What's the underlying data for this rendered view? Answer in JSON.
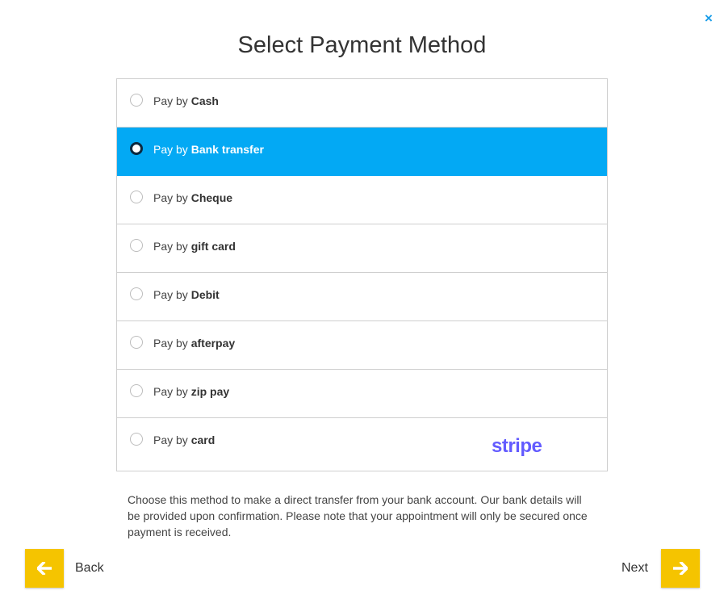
{
  "close_label": "×",
  "title": "Select Payment Method",
  "options": [
    {
      "prefix": "Pay by",
      "method": "Cash",
      "selected": false
    },
    {
      "prefix": "Pay by",
      "method": "Bank transfer",
      "selected": true
    },
    {
      "prefix": "Pay by",
      "method": "Cheque",
      "selected": false
    },
    {
      "prefix": "Pay by",
      "method": "gift card",
      "selected": false
    },
    {
      "prefix": "Pay by",
      "method": "Debit",
      "selected": false
    },
    {
      "prefix": "Pay by",
      "method": "afterpay",
      "selected": false
    },
    {
      "prefix": "Pay by",
      "method": "zip pay",
      "selected": false
    },
    {
      "prefix": "Pay by",
      "method": "card",
      "selected": false,
      "logo": "stripe"
    }
  ],
  "description": "Choose this method to make a direct transfer from your bank account. Our bank details will be provided upon confirmation. Please note that your appointment will only be secured once payment is received.",
  "footer": {
    "back_label": "Back",
    "next_label": "Next",
    "back_icon": "arrow-left-icon",
    "next_icon": "arrow-right-icon"
  },
  "colors": {
    "selected_background": "#03a9f4",
    "nav_button": "#f5c400",
    "close_icon": "#1a9de8",
    "stripe_logo": "#635bff"
  }
}
